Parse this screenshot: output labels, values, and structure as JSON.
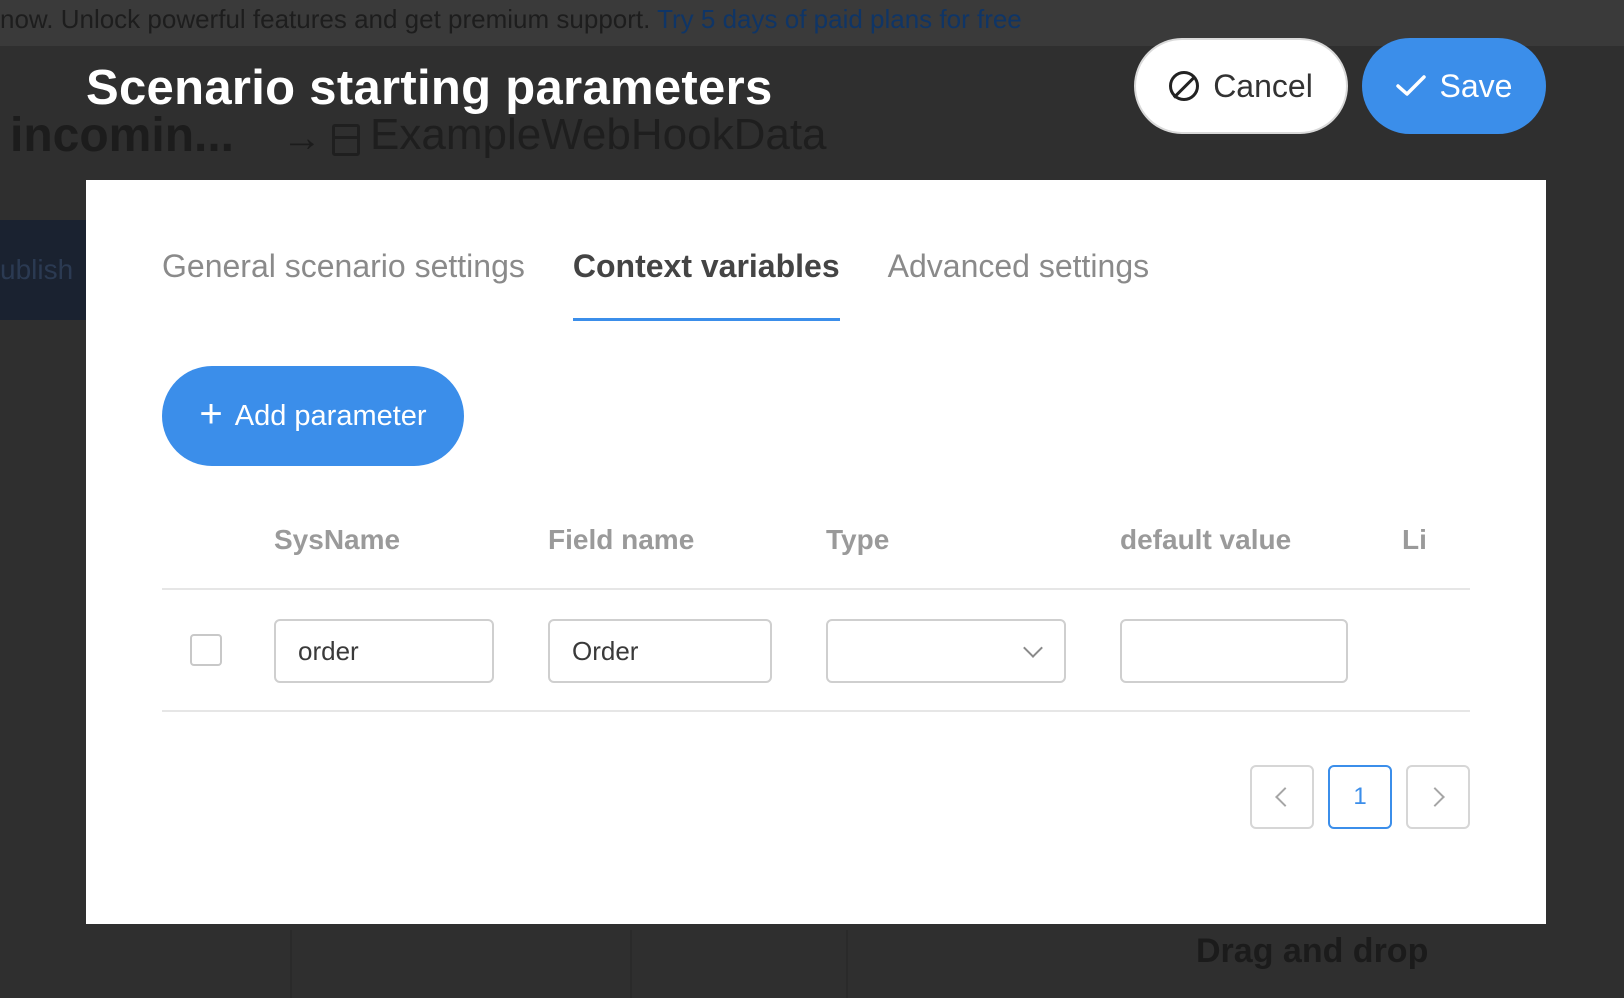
{
  "background": {
    "banner_text": "now. Unlock powerful features and get premium support.",
    "banner_link": "Try 5 days of paid plans for free",
    "page_title": "incomin...",
    "arrow": "→",
    "entity_name": "ExampleWebHookData",
    "publish_label": "ublish",
    "drag_drop_label": "Drag and drop"
  },
  "modal": {
    "title": "Scenario starting parameters",
    "cancel_label": "Cancel",
    "save_label": "Save",
    "tabs": [
      {
        "label": "General scenario settings",
        "active": false
      },
      {
        "label": "Context variables",
        "active": true
      },
      {
        "label": "Advanced settings",
        "active": false
      }
    ],
    "add_button_label": "Add parameter",
    "table": {
      "columns": [
        "SysName",
        "Field name",
        "Type",
        "default value",
        "Li"
      ],
      "rows": [
        {
          "checked": false,
          "sysname": "order",
          "field_name": "Order",
          "type": "",
          "default_value": ""
        }
      ]
    },
    "pagination": {
      "current_page": "1"
    }
  },
  "colors": {
    "accent": "#3b8eea",
    "overlay": "#2f2f2f",
    "modal_bg": "#ffffff"
  }
}
